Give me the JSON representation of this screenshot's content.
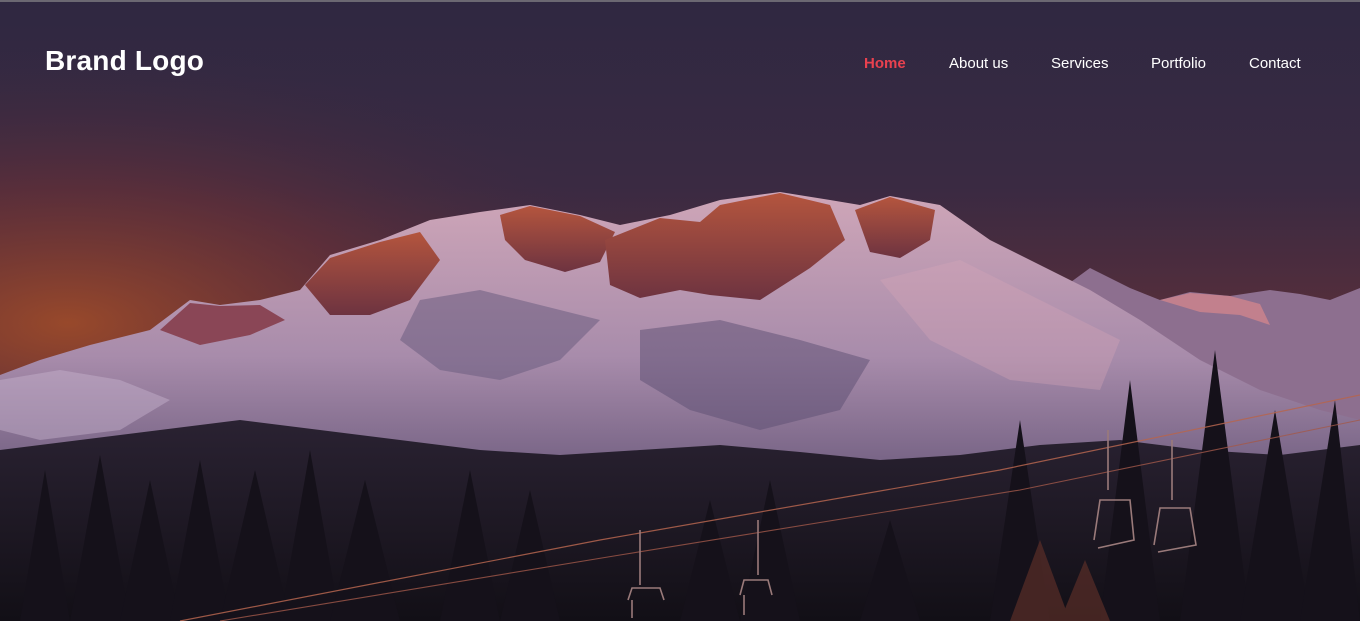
{
  "header": {
    "brand": "Brand Logo"
  },
  "nav": {
    "items": [
      {
        "label": "Home",
        "active": true
      },
      {
        "label": "About us",
        "active": false
      },
      {
        "label": "Services",
        "active": false
      },
      {
        "label": "Portfolio",
        "active": false
      },
      {
        "label": "Contact",
        "active": false
      }
    ]
  },
  "hero": {
    "image": "mountain-sunset-image"
  },
  "colors": {
    "accent": "#e8414f",
    "text": "#ffffff",
    "sky_top": "#2e2740",
    "sky_glow": "#8a3a2c",
    "snow": "#d9c9dd"
  }
}
